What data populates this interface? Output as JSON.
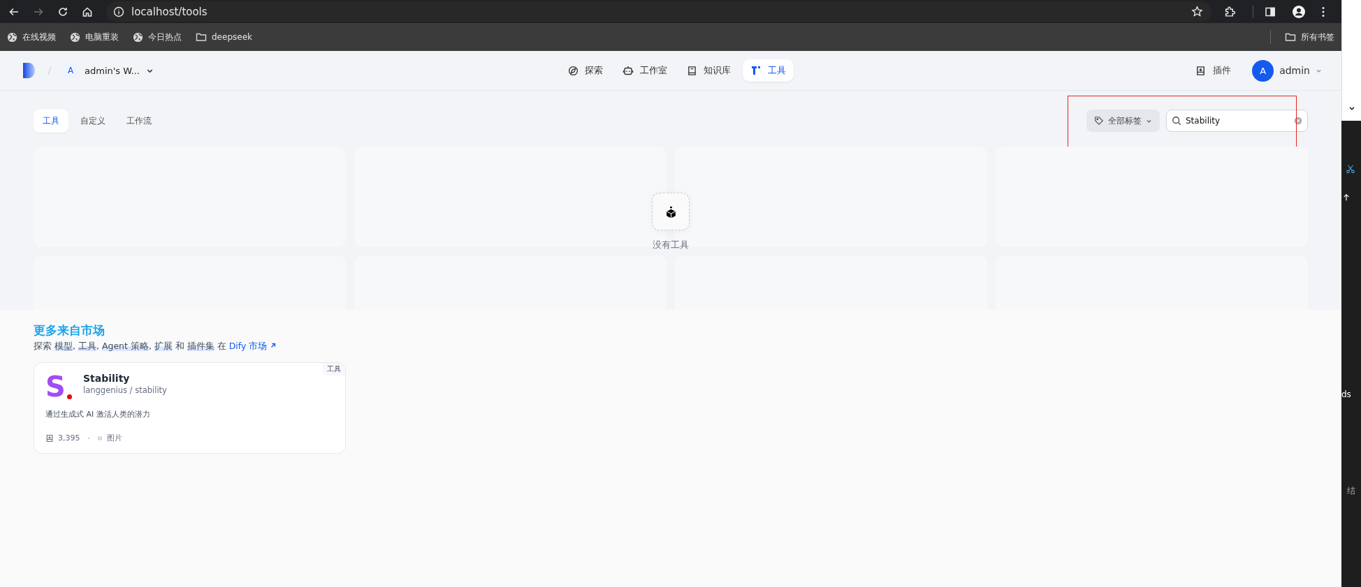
{
  "browser": {
    "buttons": [
      {
        "kind": "back",
        "disabled": false
      },
      {
        "kind": "forward",
        "disabled": true
      },
      {
        "kind": "reload",
        "disabled": false
      },
      {
        "kind": "home",
        "disabled": false
      }
    ],
    "url": "localhost/tools",
    "bookmarks": [
      {
        "label": "在线视频",
        "kind": "globe"
      },
      {
        "label": "电脑重装",
        "kind": "globe"
      },
      {
        "label": "今日热点",
        "kind": "globe"
      },
      {
        "label": "deepseek",
        "kind": "folder"
      }
    ],
    "all_bookmarks": "所有书签"
  },
  "header": {
    "workspace": {
      "initial": "A",
      "name": "admin's W..."
    },
    "nav": [
      {
        "label": "探索",
        "kind": "compass",
        "selected": false
      },
      {
        "label": "工作室",
        "kind": "robot",
        "selected": false
      },
      {
        "label": "知识库",
        "kind": "book",
        "selected": false
      },
      {
        "label": "工具",
        "kind": "tool",
        "selected": true
      }
    ],
    "plugins": "插件",
    "user": {
      "initial": "A",
      "name": "admin"
    }
  },
  "tabs": [
    {
      "label": "工具",
      "selected": true
    },
    {
      "label": "自定义",
      "selected": false
    },
    {
      "label": "工作流",
      "selected": false
    }
  ],
  "tag_filter": "全部标签",
  "search": {
    "value": "Stability"
  },
  "empty_state": "没有工具",
  "market": {
    "title": "更多来自市场",
    "intro": [
      {
        "text": "探索 ",
        "highlighted": false
      },
      {
        "text": "模型",
        "highlighted": true
      },
      {
        "text": ", ",
        "highlighted": false
      },
      {
        "text": "工具",
        "highlighted": true
      },
      {
        "text": ", ",
        "highlighted": false
      },
      {
        "text": "Agent 策略",
        "highlighted": true
      },
      {
        "text": ", ",
        "highlighted": false
      },
      {
        "text": "扩展",
        "highlighted": true
      },
      {
        "text": " 和 ",
        "highlighted": false
      },
      {
        "text": "插件集",
        "highlighted": true
      },
      {
        "text": " 在 ",
        "highlighted": false
      }
    ],
    "link": "Dify 市场",
    "cards": [
      {
        "badge": "工具",
        "logo": "S",
        "name": "Stability",
        "path": "langgenius / stability",
        "description": "通过生成式 AI 激活人类的潜力",
        "installs": "3,395",
        "tag": "图片"
      }
    ]
  },
  "side_window": {
    "texts": [
      "ds",
      "结"
    ]
  }
}
